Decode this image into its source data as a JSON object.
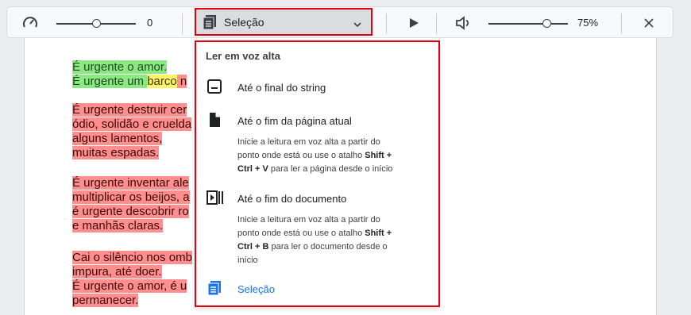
{
  "toolbar": {
    "speed_value": "0",
    "speed_fraction": 0.5,
    "dropdown_label": "Seleção",
    "volume_value": "75%",
    "volume_fraction": 0.75
  },
  "document": {
    "lines": [
      {
        "segments": [
          {
            "text": "É urgente o amor.",
            "hl": "green"
          }
        ]
      },
      {
        "segments": [
          {
            "text": "É urgente um ",
            "hl": "green"
          },
          {
            "text": "barco",
            "hl": "yellow"
          },
          {
            "text": " n",
            "hl": "red"
          }
        ]
      },
      {
        "segments": [
          {
            "text": "É urgente destruir cer",
            "hl": "red"
          }
        ]
      },
      {
        "segments": [
          {
            "text": "ódio, solidão e cruelda",
            "hl": "red"
          }
        ]
      },
      {
        "segments": [
          {
            "text": "alguns lamentos,",
            "hl": "red"
          }
        ]
      },
      {
        "segments": [
          {
            "text": "muitas espadas.",
            "hl": "red"
          }
        ]
      },
      {
        "segments": [
          {
            "text": "É urgente inventar ale",
            "hl": "red"
          }
        ]
      },
      {
        "segments": [
          {
            "text": "multiplicar os beijos, a",
            "hl": "red"
          }
        ]
      },
      {
        "segments": [
          {
            "text": "é urgente descobrir ro",
            "hl": "red"
          }
        ]
      },
      {
        "segments": [
          {
            "text": "e manhãs claras.",
            "hl": "red"
          }
        ]
      },
      {
        "segments": [
          {
            "text": "Cai o silêncio nos omb",
            "hl": "red"
          }
        ]
      },
      {
        "segments": [
          {
            "text": "impura, até doer.",
            "hl": "red"
          }
        ]
      },
      {
        "segments": [
          {
            "text": "É urgente o amor, é u",
            "hl": "red"
          }
        ]
      },
      {
        "segments": [
          {
            "text": "permanecer.",
            "hl": "red"
          }
        ]
      }
    ]
  },
  "menu": {
    "title": "Ler em voz alta",
    "item1_label": "Até o final do string",
    "item2_label": "Até o fim da página atual",
    "item2_desc": [
      "Inicie a leitura em voz alta a partir do",
      "ponto onde está ou use o atalho ",
      "Shift +",
      "Ctrl + V",
      " para ler a página desde o início"
    ],
    "item3_label": "Até o fim do documento",
    "item3_desc": [
      "Inicie a leitura em voz alta a partir do",
      "ponto onde está ou use o atalho ",
      "Shift +",
      "Ctrl + B",
      " para ler o documento desde o",
      "início"
    ],
    "item4_label": "Seleção"
  }
}
